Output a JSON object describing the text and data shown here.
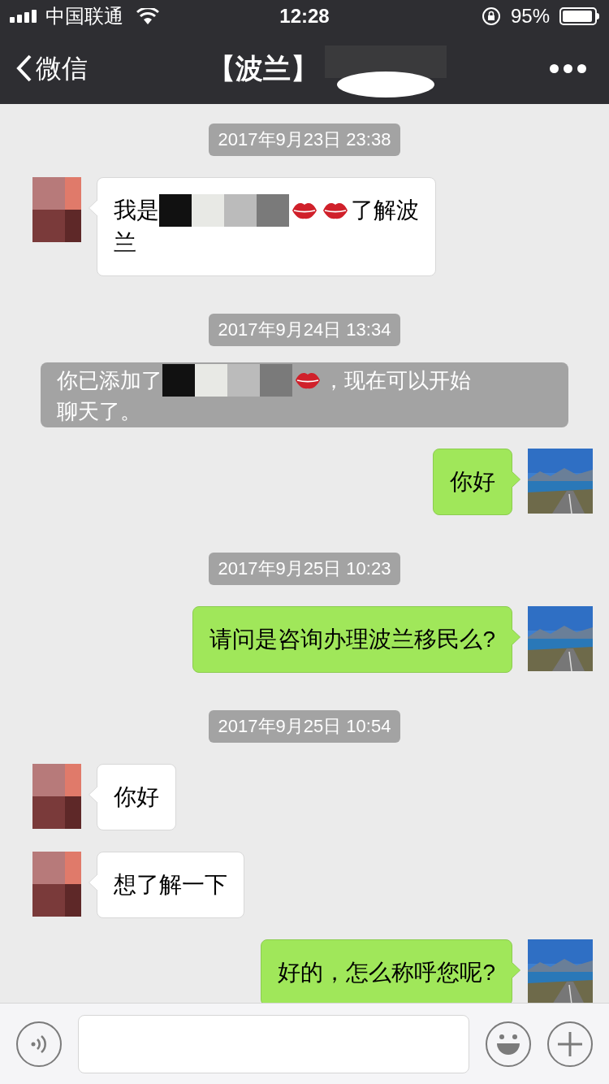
{
  "status_bar": {
    "carrier": "中国联通",
    "time": "12:28",
    "battery": "95%"
  },
  "nav": {
    "back": "微信",
    "title": "【波兰】"
  },
  "messages": [
    {
      "kind": "time",
      "text": "2017年9月23日 23:38"
    },
    {
      "kind": "received",
      "lines": [
        [
          {
            "kind": "text",
            "text": "我是"
          },
          {
            "kind": "redacted"
          },
          {
            "kind": "lips"
          },
          {
            "kind": "lips"
          },
          {
            "kind": "text",
            "text": "了解波"
          }
        ],
        [
          {
            "kind": "text",
            "text": "兰"
          }
        ]
      ]
    },
    {
      "kind": "time",
      "text": "2017年9月24日 13:34"
    },
    {
      "kind": "system",
      "lines": [
        [
          {
            "kind": "text",
            "text": "你已添加了"
          },
          {
            "kind": "redacted"
          },
          {
            "kind": "lips"
          },
          {
            "kind": "text",
            "text": "，现在可以开始"
          }
        ],
        [
          {
            "kind": "text",
            "text": "聊天了。"
          }
        ]
      ]
    },
    {
      "kind": "sent",
      "lines": [
        [
          {
            "kind": "text",
            "text": "你好"
          }
        ]
      ]
    },
    {
      "kind": "time",
      "text": "2017年9月25日 10:23"
    },
    {
      "kind": "sent",
      "lines": [
        [
          {
            "kind": "text",
            "text": "请问是咨询办理波兰移民么?"
          }
        ]
      ]
    },
    {
      "kind": "time",
      "text": "2017年9月25日 10:54"
    },
    {
      "kind": "received",
      "lines": [
        [
          {
            "kind": "text",
            "text": "你好"
          }
        ]
      ]
    },
    {
      "kind": "received",
      "lines": [
        [
          {
            "kind": "text",
            "text": "想了解一下"
          }
        ]
      ]
    },
    {
      "kind": "sent",
      "lines": [
        [
          {
            "kind": "text",
            "text": "好的，怎么称呼您呢?"
          }
        ]
      ]
    }
  ]
}
